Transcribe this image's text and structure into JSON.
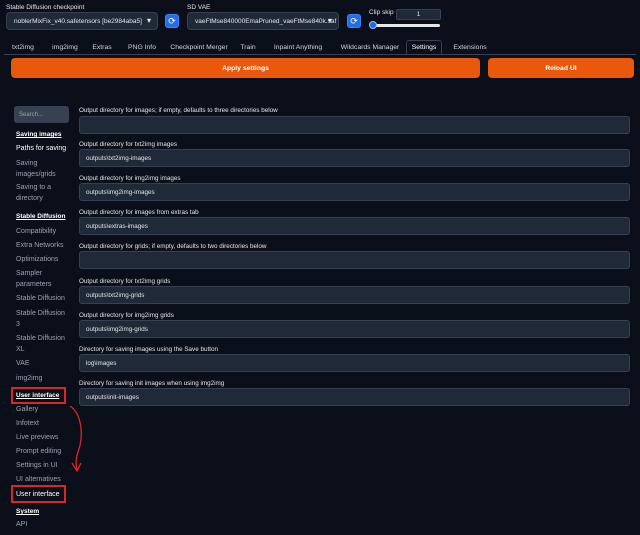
{
  "header": {
    "checkpoint_label": "Stable Diffusion checkpoint",
    "checkpoint_value": "noblerMixFix_v40.safetensors [be2984aba5]",
    "vae_label": "SD VAE",
    "vae_value": "vaeFtMse840000EmaPruned_vaeFtMse840k.saf",
    "clip_skip_label": "Clip skip",
    "clip_skip_value": "1"
  },
  "tabs": [
    "txt2img",
    "img2img",
    "Extras",
    "PNG Info",
    "Checkpoint Merger",
    "Train",
    "Inpaint Anything",
    "Wildcards Manager",
    "Settings",
    "Extensions"
  ],
  "actions": {
    "apply_label": "Apply settings",
    "reload_label": "Reload UI"
  },
  "sidebar": {
    "search_placeholder": "Search...",
    "section_saving": "Saving images",
    "paths_for_saving": "Paths for saving",
    "saving_images_grids_1": "Saving",
    "saving_images_grids_2": "images/grids",
    "saving_to_dir_1": "Saving to a",
    "saving_to_dir_2": "directory",
    "section_sd": "Stable Diffusion",
    "compatibility": "Compatibility",
    "extra_networks": "Extra Networks",
    "optimizations": "Optimizations",
    "sampler_1": "Sampler",
    "sampler_2": "parameters",
    "stable_diffusion": "Stable Diffusion",
    "sd3_1": "Stable Diffusion",
    "sd3_2": "3",
    "sdxl_1": "Stable Diffusion",
    "sdxl_2": "XL",
    "vae": "VAE",
    "img2img": "img2img",
    "section_ui": "User interface",
    "gallery": "Gallery",
    "infotext": "Infotext",
    "live_previews": "Live previews",
    "prompt_editing": "Prompt editing",
    "settings_in_ui": "Settings in UI",
    "ui_alternatives": "UI alternatives",
    "user_interface": "User interface",
    "section_system": "System",
    "api": "API"
  },
  "fields": [
    {
      "label": "Output directory for images; if empty, defaults to three directories below",
      "value": ""
    },
    {
      "label": "Output directory for txt2img images",
      "value": "outputs\\txt2img-images"
    },
    {
      "label": "Output directory for img2img images",
      "value": "outputs\\img2img-images"
    },
    {
      "label": "Output directory for images from extras tab",
      "value": "outputs\\extras-images"
    },
    {
      "label": "Output directory for grids; if empty, defaults to two directories below",
      "value": ""
    },
    {
      "label": "Output directory for txt2img grids",
      "value": "outputs\\txt2img-grids"
    },
    {
      "label": "Output directory for img2img grids",
      "value": "outputs\\img2img-grids"
    },
    {
      "label": "Directory for saving images using the Save button",
      "value": "log\\images"
    },
    {
      "label": "Directory for saving init images when using img2img",
      "value": "outputs\\init-images"
    }
  ],
  "colors": {
    "background": "#0b0f19",
    "accent_orange": "#ea580c",
    "annotation_red": "#dc2626",
    "refresh_blue": "#1f6feb"
  },
  "icons": [
    "chevron-down-icon",
    "refresh-icon",
    "arrow-annotation-icon"
  ]
}
